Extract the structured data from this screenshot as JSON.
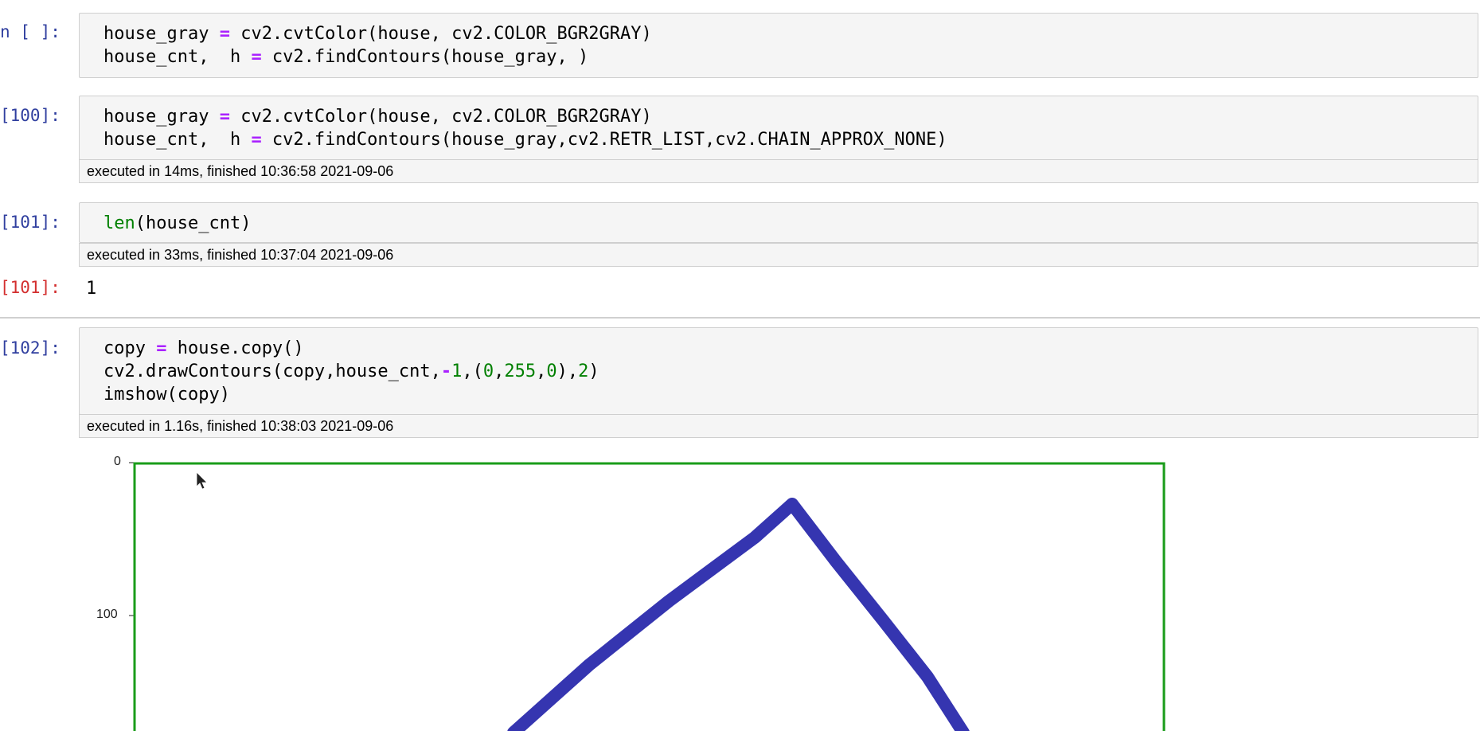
{
  "cells": [
    {
      "prompt": "n [ ]:",
      "lines": [
        [
          "house_gray ",
          "=",
          " cv2.cvtColor(house, cv2.COLOR_BGR2GRAY)"
        ],
        [
          "house_cnt,  h ",
          "=",
          " cv2.findContours(house_gray, )"
        ]
      ]
    },
    {
      "prompt": "[100]:",
      "lines": [
        [
          "house_gray ",
          "=",
          " cv2.cvtColor(house, cv2.COLOR_BGR2GRAY)"
        ],
        [
          "house_cnt,  h ",
          "=",
          " cv2.findContours(house_gray,cv2.RETR_LIST,cv2.CHAIN_APPROX_NONE)"
        ]
      ],
      "exec": "executed in 14ms, finished 10:36:58 2021-09-06"
    },
    {
      "prompt": "[101]:",
      "code_builtin": "len",
      "code_rest": "(house_cnt)",
      "exec": "executed in 33ms, finished 10:37:04 2021-09-06",
      "out_prompt": "[101]:",
      "output": "1"
    },
    {
      "prompt": "[102]:",
      "line1": [
        "copy ",
        "=",
        " house.copy()"
      ],
      "line2": {
        "a": "cv2.drawContours(copy,house_cnt,",
        "b": "-",
        "c": "1",
        "d": ",(",
        "e": "0",
        "f": ",",
        "g": "255",
        "h": ",",
        "i": "0",
        "j": "),",
        "k": "2",
        "l": ")"
      },
      "line3": "imshow(copy)",
      "exec": "executed in 1.16s, finished 10:38:03 2021-09-06"
    }
  ],
  "plot": {
    "yticks": [
      "0",
      "100"
    ],
    "frame_color": "#1a9c1a",
    "stroke_color": "#3535b0"
  }
}
